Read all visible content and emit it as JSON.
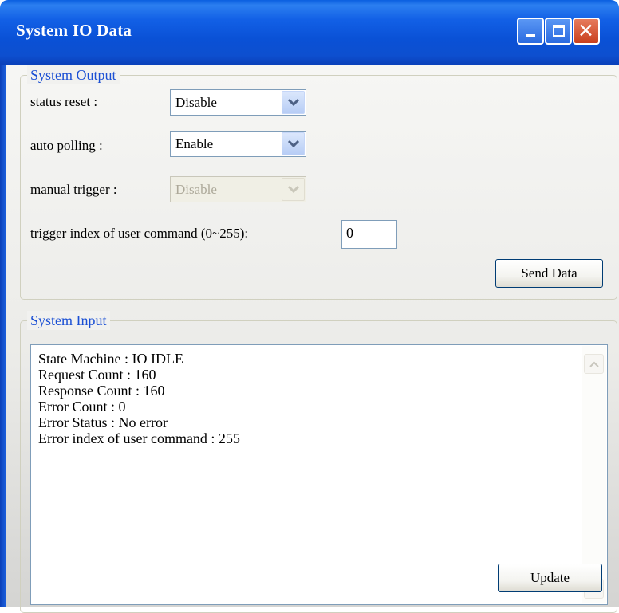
{
  "window": {
    "title": "System IO Data",
    "buttons": {
      "minimize": "minimize-icon",
      "maximize": "maximize-icon",
      "close": "close-icon"
    }
  },
  "system_output": {
    "legend": "System Output",
    "status_reset": {
      "label": "status reset :",
      "value": "Disable"
    },
    "auto_polling": {
      "label": "auto polling :",
      "value": "Enable"
    },
    "manual_trigger": {
      "label": "manual trigger :",
      "value": "Disable",
      "enabled": false
    },
    "trigger_index": {
      "label": "trigger index of user command (0~255):",
      "value": "0"
    },
    "send_button": "Send Data"
  },
  "system_input": {
    "legend": "System Input",
    "lines": [
      "State Machine : IO IDLE",
      "Request Count : 160",
      "Response Count : 160",
      "Error Count : 0",
      "Error Status : No error",
      "Error index of user command : 255"
    ],
    "update_button": "Update"
  },
  "colors": {
    "titlebar": "#0a51d6",
    "legend_text": "#1a4fd4",
    "close_button": "#c9401e",
    "disabled_text": "#aca899"
  }
}
